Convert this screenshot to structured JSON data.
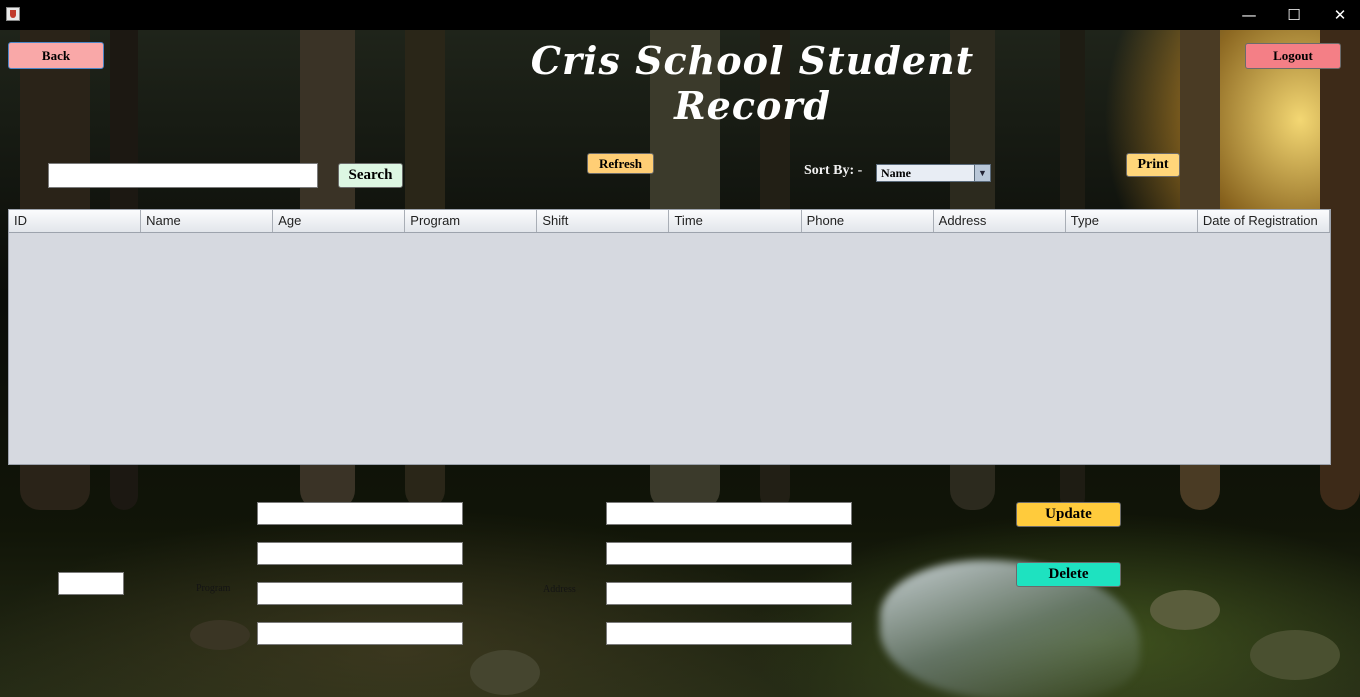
{
  "window": {
    "minimize_glyph": "—",
    "maximize_glyph": "☐",
    "close_glyph": "✕"
  },
  "header": {
    "title": "Cris School Student Record",
    "back_label": "Back",
    "logout_label": "Logout"
  },
  "toolbar": {
    "search_value": "",
    "search_label": "Search",
    "refresh_label": "Refresh",
    "sort_label": "Sort By: -",
    "sort_value": "Name",
    "print_label": "Print"
  },
  "table": {
    "columns": [
      "ID",
      "Name",
      "Age",
      "Program",
      "Shift",
      "Time",
      "Phone",
      "Address",
      "Type",
      "Date of Registration"
    ],
    "rows": []
  },
  "form": {
    "program_label": "Program",
    "address_label": "Address",
    "id_value": "",
    "left_fields": [
      "",
      "",
      "",
      ""
    ],
    "right_fields": [
      "",
      "",
      "",
      ""
    ]
  },
  "actions": {
    "update_label": "Update",
    "delete_label": "Delete"
  },
  "colors": {
    "back_button": "#f9a8a8",
    "logout_button": "#f47f86",
    "search_button": "#ddf7e3",
    "refresh_button": "#ffce75",
    "print_button": "#ffd67a",
    "update_button": "#ffcb3c",
    "delete_button": "#1ee2c0",
    "table_body": "#d6d9e0"
  }
}
